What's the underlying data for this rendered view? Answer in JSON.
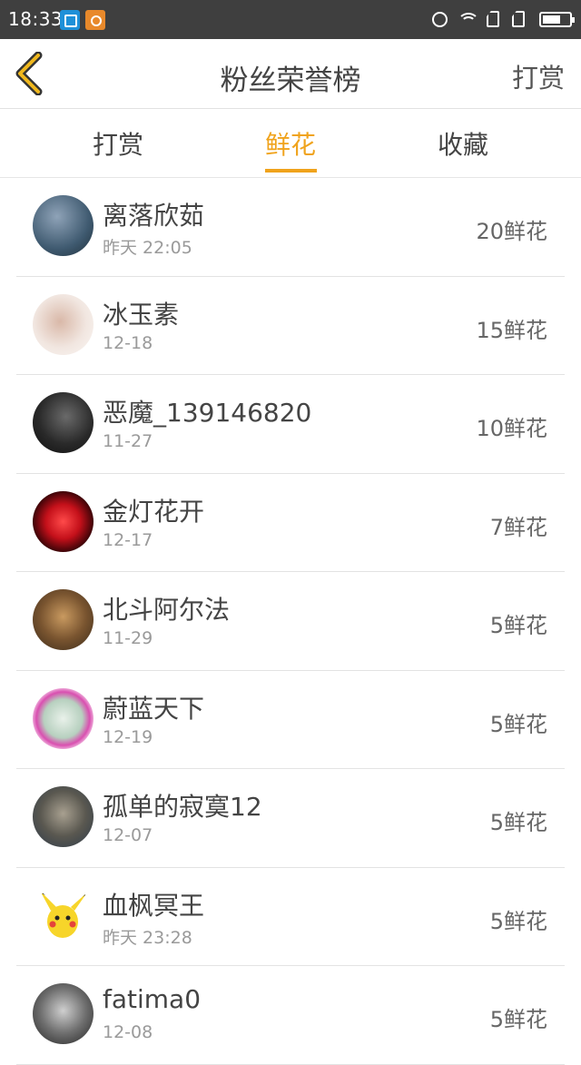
{
  "status_bar": {
    "time": "18:33",
    "icons": [
      "screenshot-icon",
      "app-notification-icon",
      "alarm-icon",
      "wifi-icon",
      "sim-card-icon",
      "sim-card-icon",
      "battery-icon"
    ]
  },
  "header": {
    "title": "粉丝荣誉榜",
    "right_action": "打赏",
    "back_icon": "chevron-left-icon",
    "accent_color": "#f0a31c"
  },
  "tabs": {
    "items": [
      "打赏",
      "鲜花",
      "收藏"
    ],
    "active": "鲜花"
  },
  "fans": [
    {
      "name": "离落欣茹",
      "date": "昨天 22:05",
      "amount": "20鲜花"
    },
    {
      "name": "冰玉素",
      "date": "12-18",
      "amount": "15鲜花"
    },
    {
      "name": "恶魔_139146820",
      "date": "11-27",
      "amount": "10鲜花"
    },
    {
      "name": "金灯花开",
      "date": "12-17",
      "amount": "7鲜花"
    },
    {
      "name": "北斗阿尔法",
      "date": "11-29",
      "amount": "5鲜花"
    },
    {
      "name": "蔚蓝天下",
      "date": "12-19",
      "amount": "5鲜花"
    },
    {
      "name": "孤单的寂寞12",
      "date": "12-07",
      "amount": "5鲜花"
    },
    {
      "name": "血枫冥王",
      "date": "昨天 23:28",
      "amount": "5鲜花"
    },
    {
      "name": "fatima0",
      "date": "12-08",
      "amount": "5鲜花"
    }
  ]
}
